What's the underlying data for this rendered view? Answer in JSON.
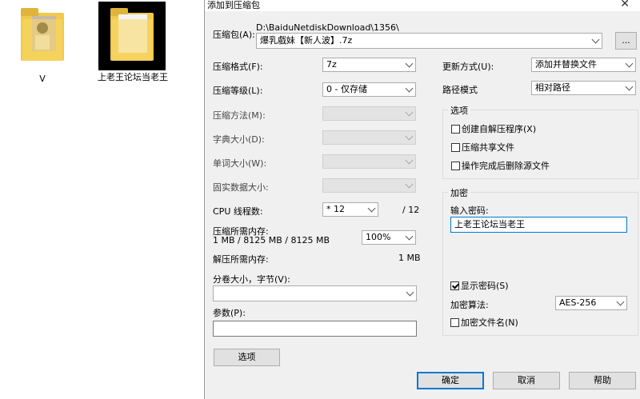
{
  "desktop": {
    "items": [
      {
        "label": "V"
      },
      {
        "label": "上老王论坛当老王"
      }
    ]
  },
  "dialog": {
    "title": "添加到压缩包",
    "close": "✕",
    "archive": {
      "label": "压缩包(A):",
      "path": "D:\\BaiduNetdiskDownload\\1356\\",
      "filename": "爆乳戲妹【新人波】.7z",
      "browse": "..."
    },
    "format": {
      "label": "压缩格式(F):",
      "value": "7z"
    },
    "level": {
      "label": "压缩等级(L):",
      "value": "0 - 仅存储"
    },
    "method": {
      "label": "压缩方法(M):",
      "value": ""
    },
    "dict": {
      "label": "字典大小(D):",
      "value": ""
    },
    "word": {
      "label": "单词大小(W):",
      "value": ""
    },
    "solid": {
      "label": "固实数据大小:",
      "value": ""
    },
    "cpu": {
      "label": "CPU 线程数:",
      "value": "* 12",
      "max": "/ 12"
    },
    "mem_compress": {
      "label": "压缩所需内存:",
      "detail": "1 MB / 8125 MB / 8125 MB",
      "percent": "100%"
    },
    "mem_decompress": {
      "label": "解压所需内存:",
      "value": "1 MB"
    },
    "split": {
      "label": "分卷大小，字节(V):",
      "value": ""
    },
    "params": {
      "label": "参数(P):",
      "value": ""
    },
    "options_button": "选项",
    "update": {
      "label": "更新方式(U):",
      "value": "添加并替换文件"
    },
    "path_mode": {
      "label": "路径模式",
      "value": "相对路径"
    },
    "options_group": {
      "title": "选项",
      "sfx": "创建自解压程序(X)",
      "shared": "压缩共享文件",
      "delete": "操作完成后删除源文件"
    },
    "encryption": {
      "title": "加密",
      "password_label": "输入密码:",
      "password": "上老王论坛当老王",
      "show_password": "显示密码(S)",
      "method_label": "加密算法:",
      "method_value": "AES-256",
      "encrypt_names": "加密文件名(N)"
    },
    "buttons": {
      "ok": "确定",
      "cancel": "取消",
      "help": "帮助"
    }
  }
}
